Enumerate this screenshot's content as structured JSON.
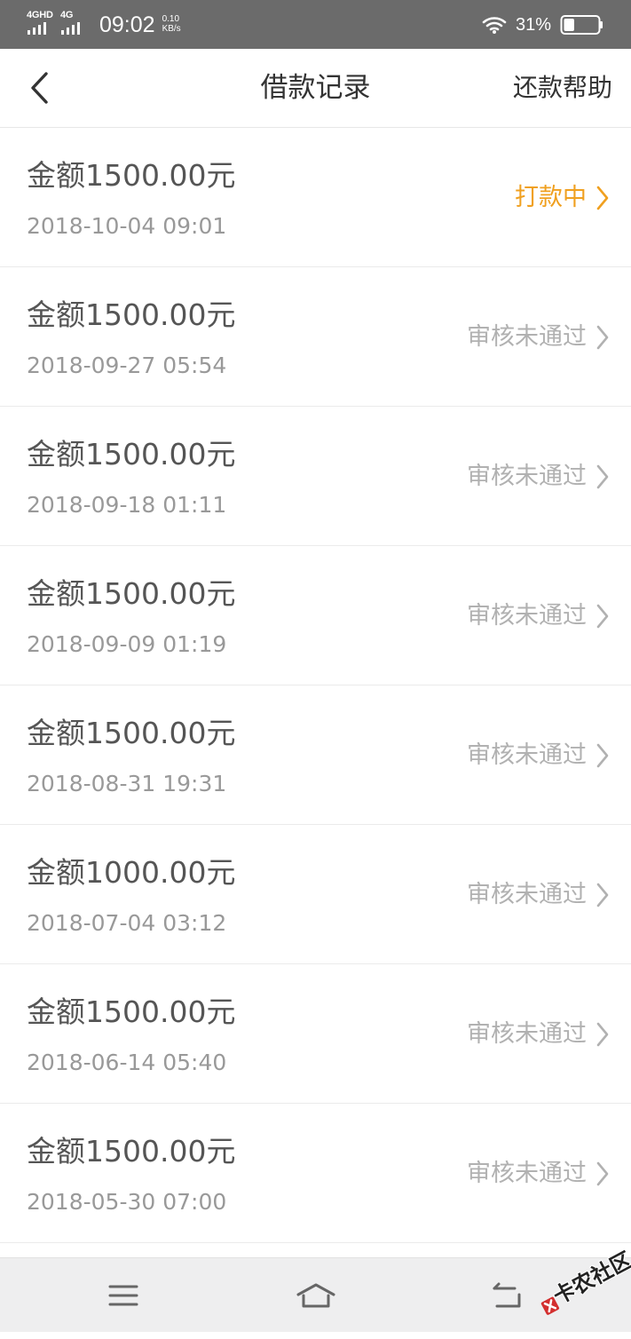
{
  "status_bar": {
    "signal_1_label": "4GHD",
    "signal_2_label": "4G",
    "time": "09:02",
    "network_speed_value": "0.10",
    "network_speed_unit": "KB/s",
    "battery_percent": "31%",
    "battery_level_percent": 31,
    "colors": {
      "background": "#6b6b6b",
      "foreground": "#ffffff"
    },
    "icons": {
      "signal": "cellular-signal-icon",
      "wifi": "wifi-icon",
      "battery": "battery-icon"
    }
  },
  "header": {
    "title": "借款记录",
    "help_label": "还款帮助",
    "back_icon": "back-arrow-icon"
  },
  "loans": [
    {
      "amount": "金额1500.00元",
      "date": "2018-10-04 09:01",
      "status": "打款中",
      "status_type": "processing"
    },
    {
      "amount": "金额1500.00元",
      "date": "2018-09-27 05:54",
      "status": "审核未通过",
      "status_type": "rejected"
    },
    {
      "amount": "金额1500.00元",
      "date": "2018-09-18 01:11",
      "status": "审核未通过",
      "status_type": "rejected"
    },
    {
      "amount": "金额1500.00元",
      "date": "2018-09-09 01:19",
      "status": "审核未通过",
      "status_type": "rejected"
    },
    {
      "amount": "金额1500.00元",
      "date": "2018-08-31 19:31",
      "status": "审核未通过",
      "status_type": "rejected"
    },
    {
      "amount": "金额1000.00元",
      "date": "2018-07-04 03:12",
      "status": "审核未通过",
      "status_type": "rejected"
    },
    {
      "amount": "金额1500.00元",
      "date": "2018-06-14 05:40",
      "status": "审核未通过",
      "status_type": "rejected"
    },
    {
      "amount": "金额1500.00元",
      "date": "2018-05-30 07:00",
      "status": "审核未通过",
      "status_type": "rejected"
    }
  ],
  "bottom_nav": {
    "icons": {
      "menu": "menu-icon",
      "home": "home-icon",
      "back": "back-nav-icon"
    },
    "background": "#eeeeef"
  },
  "watermark": {
    "text": "卡农社区",
    "badge_color": "#d32f2f"
  },
  "colors": {
    "processing_status": "#f0a020",
    "rejected_status": "#b1b1b1",
    "amount_text": "#555555",
    "date_text": "#999999",
    "divider": "#ebebeb"
  }
}
